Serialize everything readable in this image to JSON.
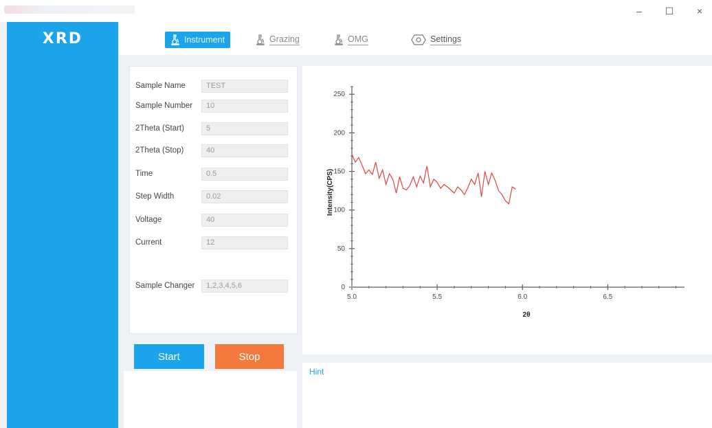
{
  "app": {
    "logo": "XRD",
    "window_controls": [
      "–",
      "☐",
      "×"
    ]
  },
  "tabs": [
    {
      "label": "Instrument",
      "icon": "microscope-icon",
      "active": true
    },
    {
      "label": "Grazing",
      "icon": "microscope-icon",
      "active": false
    },
    {
      "label": "OMG",
      "icon": "microscope-icon",
      "active": false
    },
    {
      "label": "Settings",
      "icon": "gear-icon",
      "active": false
    }
  ],
  "form": {
    "sample_name": {
      "label": "Sample Name",
      "value": "TEST"
    },
    "sample_number": {
      "label": "Sample Number",
      "value": "10"
    },
    "two_theta_start": {
      "label": "2Theta (Start)",
      "value": "5"
    },
    "two_theta_stop": {
      "label": "2Theta (Stop)",
      "value": "40"
    },
    "time": {
      "label": "Time",
      "value": "0.5"
    },
    "step_width": {
      "label": "Step Width",
      "value": "0.02"
    },
    "voltage": {
      "label": "Voltage",
      "value": "40"
    },
    "current": {
      "label": "Current",
      "value": "12"
    },
    "sample_changer": {
      "label": "Sample Changer",
      "value": "1,2,3,4,5,6"
    }
  },
  "buttons": {
    "start": "Start",
    "stop": "Stop"
  },
  "hint": {
    "label": "Hint"
  },
  "colors": {
    "accent": "#1ba4ea",
    "stop": "#f37a3c",
    "line": "#e0443c"
  },
  "chart_data": {
    "type": "line",
    "xlabel": "2θ",
    "ylabel": "Intensity(CPS)",
    "xlim": [
      5.0,
      6.95
    ],
    "ylim": [
      0,
      260
    ],
    "xticks": [
      "5.0",
      "5.5",
      "6.0",
      "6.5"
    ],
    "yticks": [
      "0",
      "50",
      "100",
      "150",
      "200",
      "250"
    ],
    "grid": false,
    "series": [
      {
        "x": [
          5.0,
          5.02,
          5.04,
          5.06,
          5.08,
          5.1,
          5.12,
          5.14,
          5.16,
          5.18,
          5.2,
          5.22,
          5.24,
          5.26,
          5.28,
          5.3,
          5.32,
          5.34,
          5.36,
          5.38,
          5.4,
          5.42,
          5.44,
          5.46,
          5.48,
          5.5,
          5.52,
          5.54,
          5.56,
          5.58,
          5.6,
          5.62,
          5.64,
          5.66,
          5.68,
          5.7,
          5.72,
          5.74,
          5.76,
          5.78,
          5.8,
          5.82,
          5.84,
          5.86,
          5.88,
          5.9,
          5.92,
          5.94,
          5.96
        ],
        "y": [
          172,
          162,
          168,
          158,
          147,
          152,
          146,
          162,
          141,
          152,
          133,
          147,
          140,
          122,
          143,
          128,
          126,
          132,
          143,
          130,
          144,
          135,
          157,
          130,
          140,
          136,
          128,
          133,
          130,
          126,
          122,
          130,
          126,
          120,
          129,
          140,
          133,
          148,
          117,
          150,
          133,
          148,
          138,
          125,
          120,
          112,
          108,
          130,
          127
        ]
      }
    ]
  }
}
